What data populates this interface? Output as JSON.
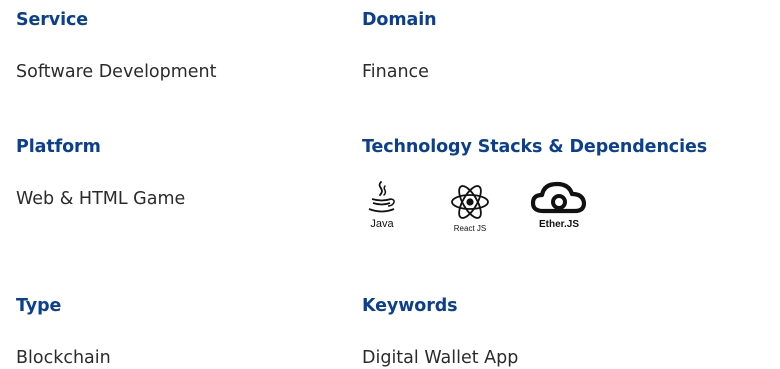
{
  "service": {
    "label": "Service",
    "value": "Software Development"
  },
  "domain": {
    "label": "Domain",
    "value": "Finance"
  },
  "platform": {
    "label": "Platform",
    "value": "Web & HTML Game"
  },
  "tech": {
    "label": "Technology Stacks & Dependencies",
    "logos": [
      {
        "icon": "java-icon",
        "caption": "Java"
      },
      {
        "icon": "react-icon",
        "caption": "React JS"
      },
      {
        "icon": "cloud-icon",
        "caption": "Ether.JS"
      }
    ]
  },
  "type": {
    "label": "Type",
    "value": "Blockchain"
  },
  "keywords": {
    "label": "Keywords",
    "value": "Digital Wallet App"
  },
  "colors": {
    "label": "#0b3f91",
    "value": "#2b2b2b",
    "logo": "#111111"
  }
}
